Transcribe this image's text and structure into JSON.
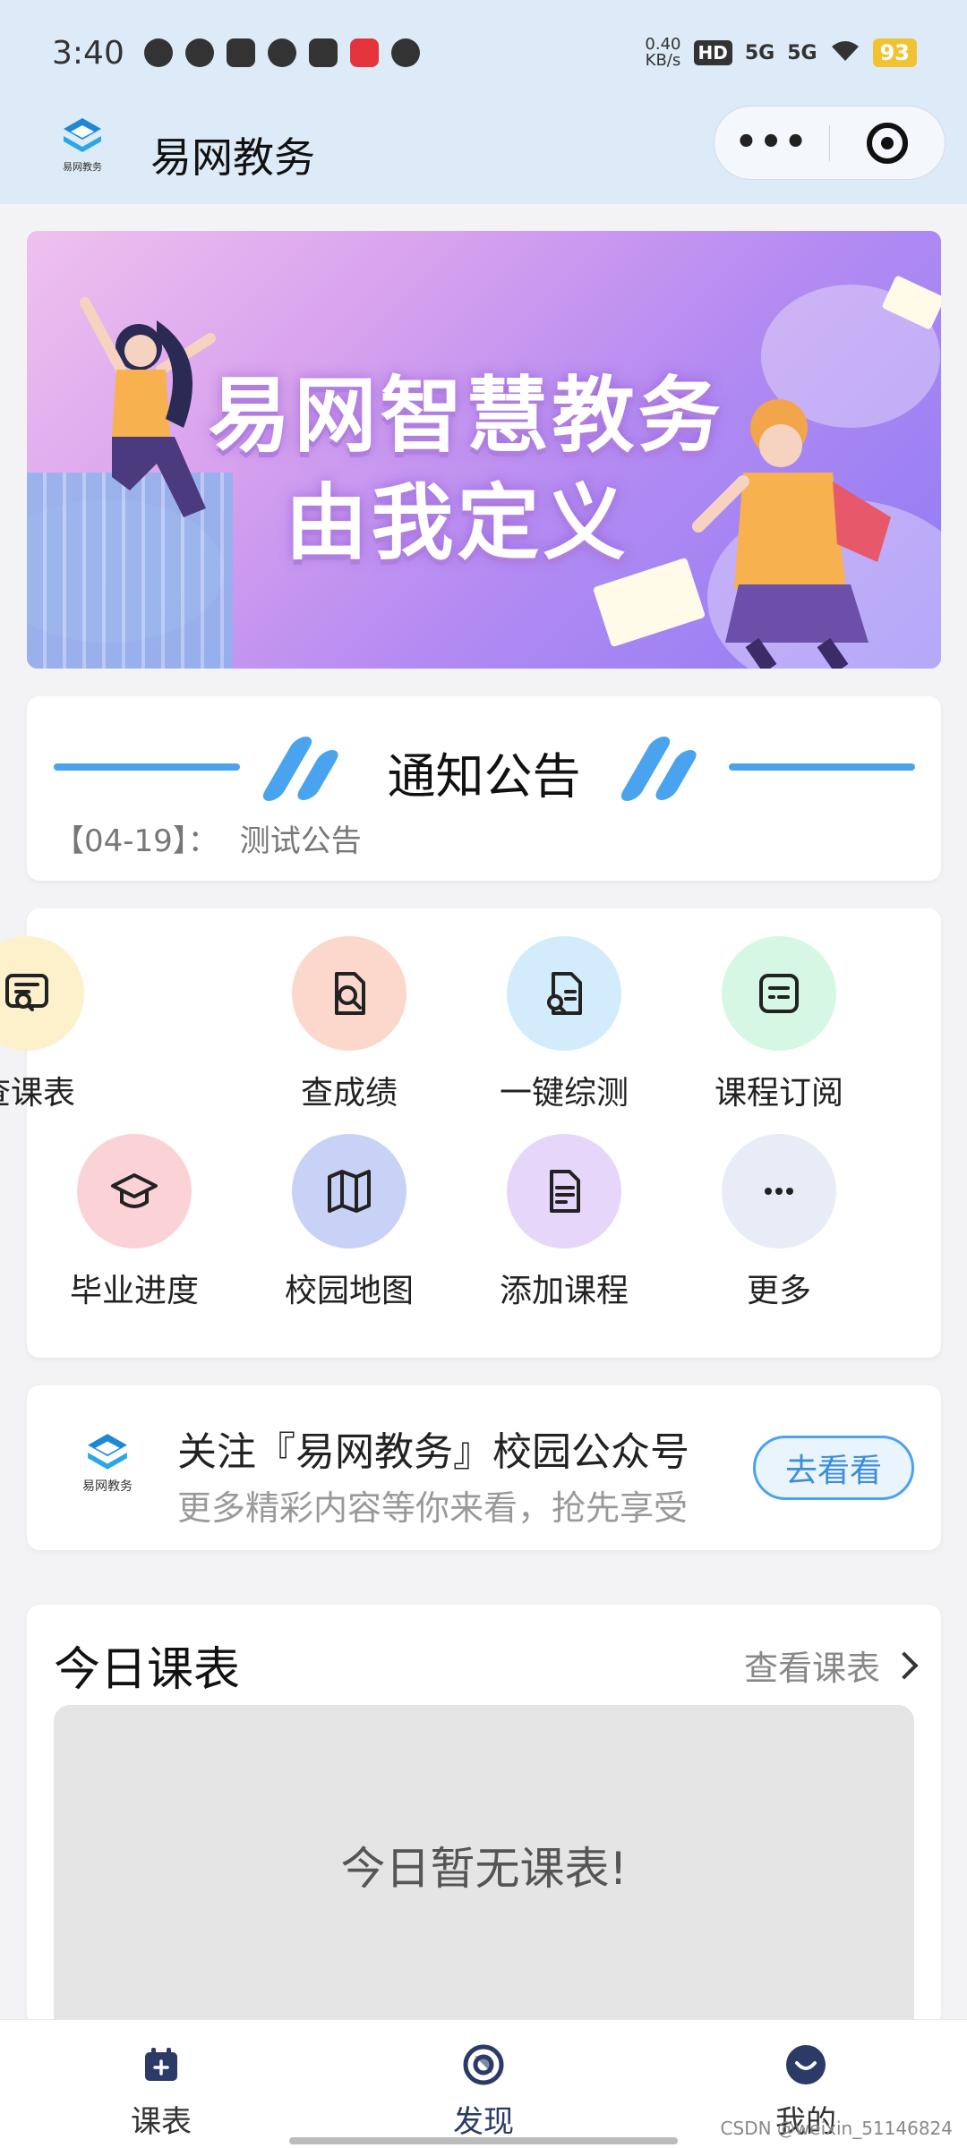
{
  "status_bar": {
    "time": "3:40",
    "net_speed_value": "0.40",
    "net_speed_unit": "KB/s",
    "hd": "HD",
    "signal1": "5G",
    "signal2": "5G",
    "battery": "93"
  },
  "header": {
    "app_title": "易网教务",
    "logo_text": "易网教务",
    "menu_label": "•••"
  },
  "banner": {
    "line1": "易网智慧教务",
    "line2": "由我定义"
  },
  "notice": {
    "title": "通知公告",
    "items": [
      {
        "date": "【04-19】：",
        "text": "测试公告"
      }
    ]
  },
  "features": [
    {
      "label": "查课表",
      "icon": "schedule-search-icon",
      "color": "#fdf1cc"
    },
    {
      "label": "查成绩",
      "icon": "grade-search-icon",
      "color": "#fbd8cb"
    },
    {
      "label": "一键综测",
      "icon": "doc-search-icon",
      "color": "#d3ecfb"
    },
    {
      "label": "课程订阅",
      "icon": "subscription-icon",
      "color": "#d6f7e3"
    },
    {
      "label": "毕业进度",
      "icon": "graduation-cap-icon",
      "color": "#fbd3d6"
    },
    {
      "label": "校园地图",
      "icon": "map-icon",
      "color": "#c8d2f6"
    },
    {
      "label": "添加课程",
      "icon": "document-icon",
      "color": "#e6d6fa"
    },
    {
      "label": "更多",
      "icon": "more-dots-icon",
      "color": "#e7ecf6"
    }
  ],
  "follow": {
    "title": "关注『易网教务』校园公众号",
    "subtitle": "更多精彩内容等你来看，抢先享受",
    "button": "去看看",
    "logo_text": "易网教务"
  },
  "today": {
    "title": "今日课表",
    "link": "查看课表",
    "empty_text": "今日暂无课表!"
  },
  "tabbar": {
    "tabs": [
      {
        "label": "课表",
        "icon": "calendar-icon",
        "active": false
      },
      {
        "label": "发现",
        "icon": "discover-icon",
        "active": true
      },
      {
        "label": "我的",
        "icon": "profile-icon",
        "active": false
      }
    ]
  },
  "watermark": "CSDN @weixin_51146824",
  "colors": {
    "accent": "#4aa3ef",
    "header_bg": "#dcebf7",
    "tab_active": "#2b3a67"
  }
}
